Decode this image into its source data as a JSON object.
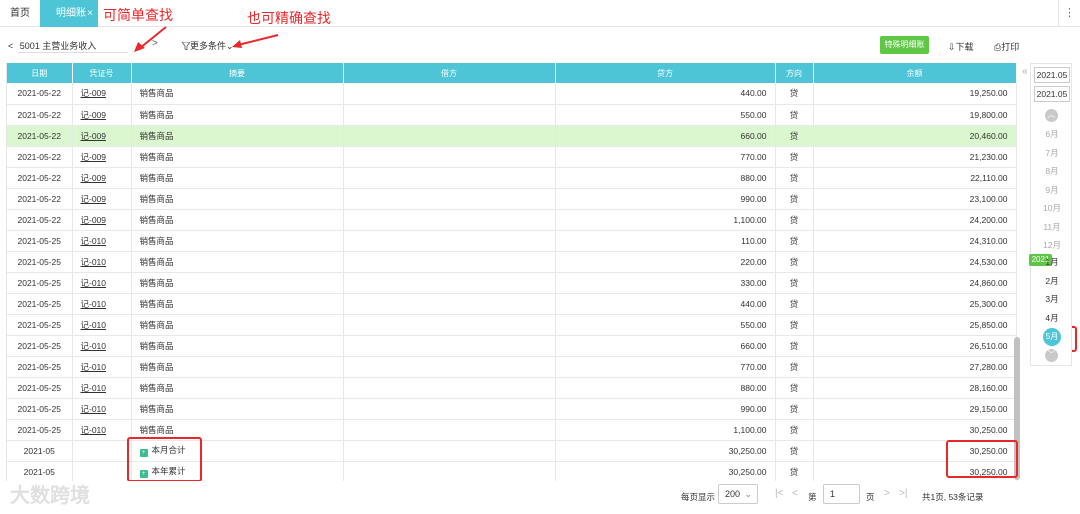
{
  "tabs": {
    "home": "首页",
    "active": "明细账",
    "close": "×"
  },
  "annotations": {
    "simple": "可简单查找",
    "exact": "也可精确查找"
  },
  "toolbar": {
    "account": "5001 主营业务收入",
    "prev": "<",
    "next": ">",
    "more_conditions": "更多条件",
    "special_detail": "特殊明细账",
    "download": "下载",
    "print": "打印"
  },
  "table": {
    "headers": [
      "日期",
      "凭证号",
      "摘要",
      "借方",
      "贷方",
      "方向",
      "余额"
    ],
    "rows": [
      {
        "date": "2021-05-22",
        "voucher": "记-009",
        "summary": "销售商品",
        "debit": "",
        "credit": "440.00",
        "dir": "贷",
        "balance": "19,250.00"
      },
      {
        "date": "2021-05-22",
        "voucher": "记-009",
        "summary": "销售商品",
        "debit": "",
        "credit": "550.00",
        "dir": "贷",
        "balance": "19,800.00"
      },
      {
        "date": "2021-05-22",
        "voucher": "记-009",
        "summary": "销售商品",
        "debit": "",
        "credit": "660.00",
        "dir": "贷",
        "balance": "20,460.00"
      },
      {
        "date": "2021-05-22",
        "voucher": "记-009",
        "summary": "销售商品",
        "debit": "",
        "credit": "770.00",
        "dir": "贷",
        "balance": "21,230.00"
      },
      {
        "date": "2021-05-22",
        "voucher": "记-009",
        "summary": "销售商品",
        "debit": "",
        "credit": "880.00",
        "dir": "贷",
        "balance": "22,110.00"
      },
      {
        "date": "2021-05-22",
        "voucher": "记-009",
        "summary": "销售商品",
        "debit": "",
        "credit": "990.00",
        "dir": "贷",
        "balance": "23,100.00"
      },
      {
        "date": "2021-05-22",
        "voucher": "记-009",
        "summary": "销售商品",
        "debit": "",
        "credit": "1,100.00",
        "dir": "贷",
        "balance": "24,200.00"
      },
      {
        "date": "2021-05-25",
        "voucher": "记-010",
        "summary": "销售商品",
        "debit": "",
        "credit": "110.00",
        "dir": "贷",
        "balance": "24,310.00"
      },
      {
        "date": "2021-05-25",
        "voucher": "记-010",
        "summary": "销售商品",
        "debit": "",
        "credit": "220.00",
        "dir": "贷",
        "balance": "24,530.00"
      },
      {
        "date": "2021-05-25",
        "voucher": "记-010",
        "summary": "销售商品",
        "debit": "",
        "credit": "330.00",
        "dir": "贷",
        "balance": "24,860.00"
      },
      {
        "date": "2021-05-25",
        "voucher": "记-010",
        "summary": "销售商品",
        "debit": "",
        "credit": "440.00",
        "dir": "贷",
        "balance": "25,300.00"
      },
      {
        "date": "2021-05-25",
        "voucher": "记-010",
        "summary": "销售商品",
        "debit": "",
        "credit": "550.00",
        "dir": "贷",
        "balance": "25,850.00"
      },
      {
        "date": "2021-05-25",
        "voucher": "记-010",
        "summary": "销售商品",
        "debit": "",
        "credit": "660.00",
        "dir": "贷",
        "balance": "26,510.00"
      },
      {
        "date": "2021-05-25",
        "voucher": "记-010",
        "summary": "销售商品",
        "debit": "",
        "credit": "770.00",
        "dir": "贷",
        "balance": "27,280.00"
      },
      {
        "date": "2021-05-25",
        "voucher": "记-010",
        "summary": "销售商品",
        "debit": "",
        "credit": "880.00",
        "dir": "贷",
        "balance": "28,160.00"
      },
      {
        "date": "2021-05-25",
        "voucher": "记-010",
        "summary": "销售商品",
        "debit": "",
        "credit": "990.00",
        "dir": "贷",
        "balance": "29,150.00"
      },
      {
        "date": "2021-05-25",
        "voucher": "记-010",
        "summary": "销售商品",
        "debit": "",
        "credit": "1,100.00",
        "dir": "贷",
        "balance": "30,250.00"
      },
      {
        "date": "2021-05",
        "voucher": "",
        "summary": "本月合计",
        "debit": "",
        "credit": "30,250.00",
        "dir": "贷",
        "balance": "30,250.00",
        "total": true
      },
      {
        "date": "2021-05",
        "voucher": "",
        "summary": "本年累计",
        "debit": "",
        "credit": "30,250.00",
        "dir": "贷",
        "balance": "30,250.00",
        "total": true
      }
    ],
    "highlight_row": 2,
    "highlight_color": "#dbf7cf",
    "header_color": "#4ec5d6"
  },
  "period_panel": {
    "start": "2021.05",
    "end": "2021.05",
    "months_prev": [
      "6月",
      "7月",
      "8月",
      "9月",
      "10月",
      "11月",
      "12月"
    ],
    "year_badge": "2021",
    "months_year": [
      "1月",
      "2月",
      "3月",
      "4月"
    ],
    "selected": "5月",
    "collapse": "«"
  },
  "footer": {
    "page_size_label": "每页显示",
    "page_size": "200",
    "page_prefix": "第",
    "page": "1",
    "page_suffix": "页",
    "summary": "共1页, 53条记录"
  },
  "watermark": "大数跨境"
}
